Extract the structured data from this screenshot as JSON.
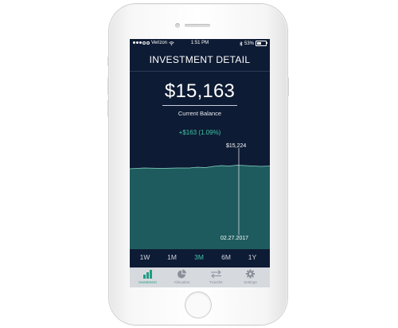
{
  "status_bar": {
    "carrier": "Verizon",
    "time": "1:51 PM",
    "battery": "53%"
  },
  "title": "INVESTMENT DETAIL",
  "balance": {
    "amount": "$15,163",
    "label": "Current Balance",
    "change": "+$163 (1.09%)"
  },
  "chart": {
    "peak_label": "$15,224",
    "date_label": "02.27.2017"
  },
  "ranges": [
    "1W",
    "1M",
    "3M",
    "6M",
    "1Y"
  ],
  "active_range": "3M",
  "tabs": [
    {
      "label": "Investment",
      "icon": "bar-chart-icon",
      "active": true
    },
    {
      "label": "Allocation",
      "icon": "pie-chart-icon",
      "active": false
    },
    {
      "label": "Transfer",
      "icon": "transfer-arrows-icon",
      "active": false
    },
    {
      "label": "Settings",
      "icon": "gear-icon",
      "active": false
    }
  ],
  "colors": {
    "background": "#0e1b34",
    "accent": "#3cc7a6",
    "chart_fill": "#1e5b5e",
    "tabbar": "#d6d9de"
  }
}
